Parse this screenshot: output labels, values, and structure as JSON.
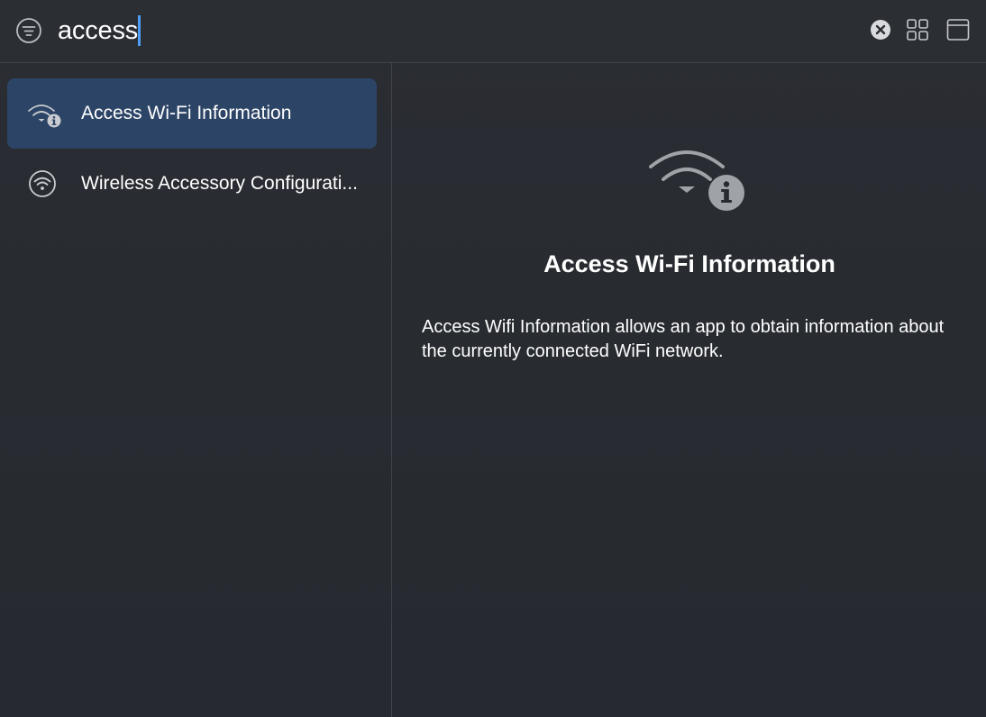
{
  "search": {
    "query": "access"
  },
  "toolbar": {
    "filter_icon": "filter-icon",
    "clear_icon": "clear-icon",
    "grid_icon": "grid-view-icon",
    "window_icon": "window-icon"
  },
  "results": [
    {
      "label": "Access Wi-Fi Information",
      "icon": "wifi-info-icon",
      "selected": true
    },
    {
      "label": "Wireless Accessory Configurati...",
      "icon": "wifi-circle-icon",
      "selected": false
    }
  ],
  "detail": {
    "icon": "wifi-info-icon",
    "title": "Access Wi-Fi Information",
    "description": "Access Wifi Information allows an app to obtain information about the currently connected WiFi network."
  },
  "colors": {
    "selection": "#2c4466",
    "caret": "#4c9df7",
    "background": "#272a2f"
  }
}
